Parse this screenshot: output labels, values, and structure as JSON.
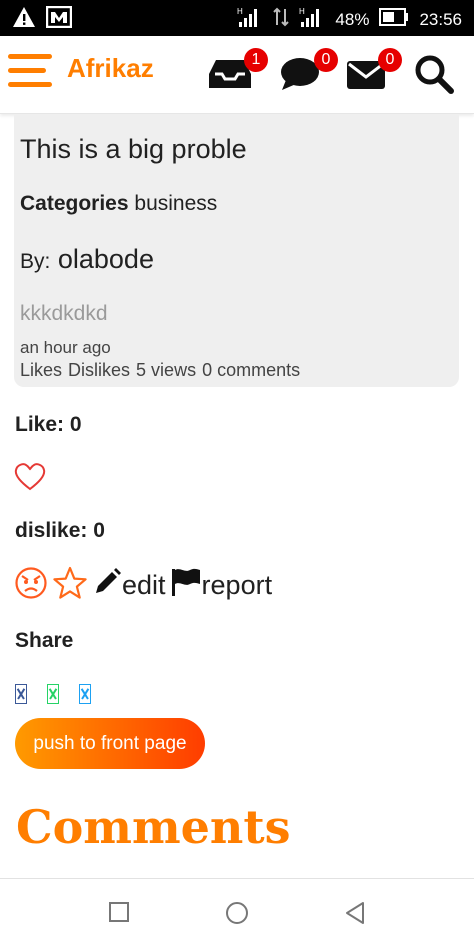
{
  "status_bar": {
    "battery_percent": "48%",
    "time": "23:56"
  },
  "header": {
    "brand": "Afrikaz",
    "brand_color": "#ff7e00",
    "notifications": {
      "icon": "inbox-tray-icon",
      "count": "1"
    },
    "messages": {
      "icon": "speech-bubbles-icon",
      "count": "0"
    },
    "mail": {
      "icon": "envelope-icon",
      "count": "0"
    },
    "search_icon": "search-icon"
  },
  "post": {
    "title": "This is a big proble",
    "categories_label": "Categories",
    "category": "business",
    "by_label": "By:",
    "author": "olabode",
    "body": "kkkdkdkd",
    "time": "an hour ago",
    "stats": {
      "likes": "Likes",
      "dislikes": "Dislikes",
      "views": "5 views",
      "comments": "0 comments"
    }
  },
  "reactions": {
    "like_label": "Like: 0",
    "dislike_label": "dislike: 0",
    "edit_label": "edit",
    "report_label": "report"
  },
  "share": {
    "label": "Share",
    "icon_colors": [
      "#3b5998",
      "#25d366",
      "#1da1f2"
    ]
  },
  "push_button": "push to front page",
  "comments_heading": "Comments"
}
